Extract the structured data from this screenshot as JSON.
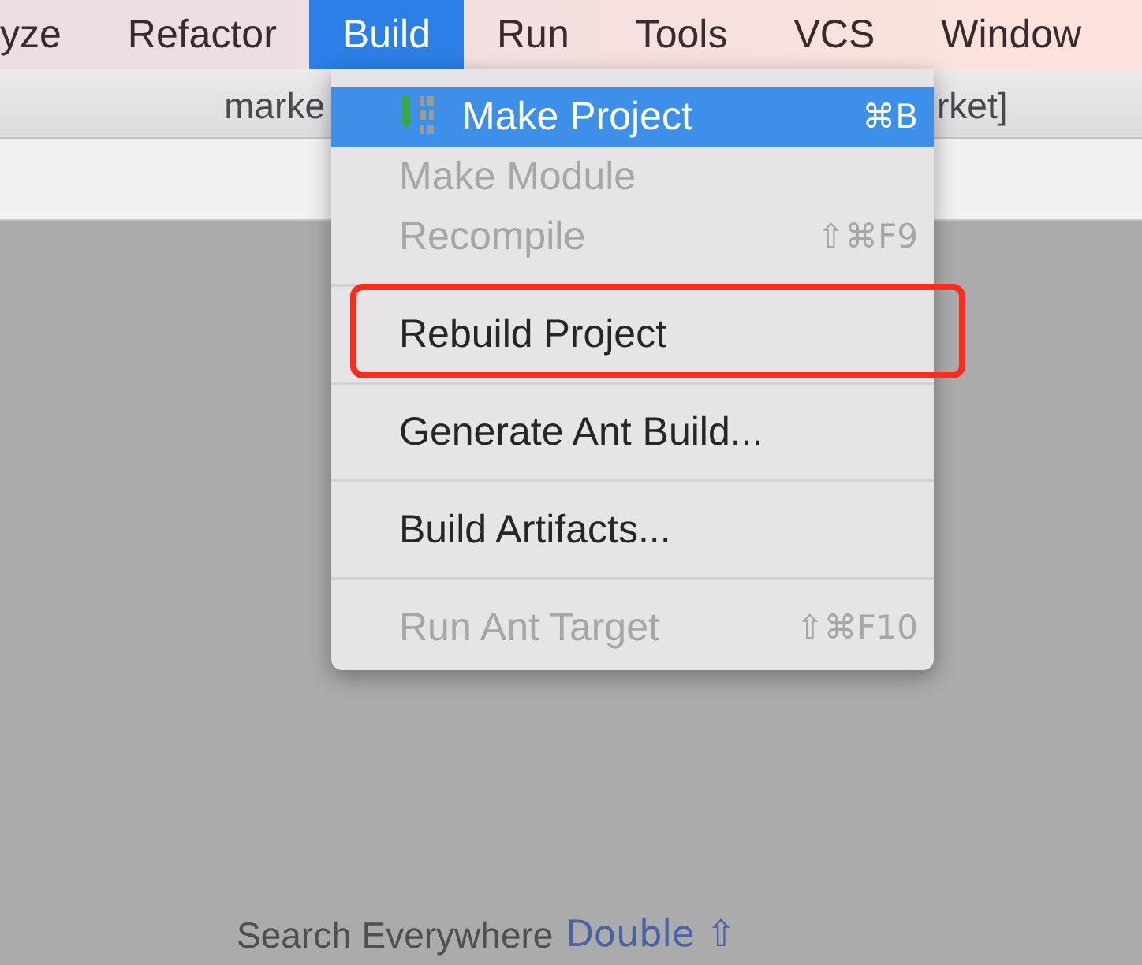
{
  "menu_bar": {
    "items": [
      {
        "label": "yze",
        "selected": false
      },
      {
        "label": "Refactor",
        "selected": false
      },
      {
        "label": "Build",
        "selected": true
      },
      {
        "label": "Run",
        "selected": false
      },
      {
        "label": "Tools",
        "selected": false
      },
      {
        "label": "VCS",
        "selected": false
      },
      {
        "label": "Window",
        "selected": false
      }
    ]
  },
  "title_bar": {
    "title_parts": [
      "marke",
      "rket]"
    ]
  },
  "build_menu": {
    "items": [
      {
        "kind": "item",
        "label": "Make Project",
        "shortcut": "⌘B",
        "icon": true,
        "selected": true,
        "disabled": false,
        "annotated": false
      },
      {
        "kind": "item",
        "label": "Make Module",
        "selected": false,
        "disabled": true,
        "annotated": false
      },
      {
        "kind": "item",
        "label": "Recompile",
        "shortcut": "⇧⌘F9",
        "selected": false,
        "disabled": true,
        "annotated": false
      },
      {
        "kind": "separator"
      },
      {
        "kind": "item",
        "label": "Rebuild Project",
        "selected": false,
        "disabled": false,
        "annotated": true
      },
      {
        "kind": "separator"
      },
      {
        "kind": "item",
        "label": "Generate Ant Build...",
        "selected": false,
        "disabled": false,
        "annotated": false
      },
      {
        "kind": "separator"
      },
      {
        "kind": "item",
        "label": "Build Artifacts...",
        "selected": false,
        "disabled": false,
        "annotated": false
      },
      {
        "kind": "separator"
      },
      {
        "kind": "item",
        "label": "Run Ant Target",
        "shortcut": "⇧⌘F10",
        "selected": false,
        "disabled": true,
        "annotated": false
      }
    ]
  },
  "search_hint": {
    "text": "Search Everywhere",
    "shortcut": "Double ⇧"
  }
}
